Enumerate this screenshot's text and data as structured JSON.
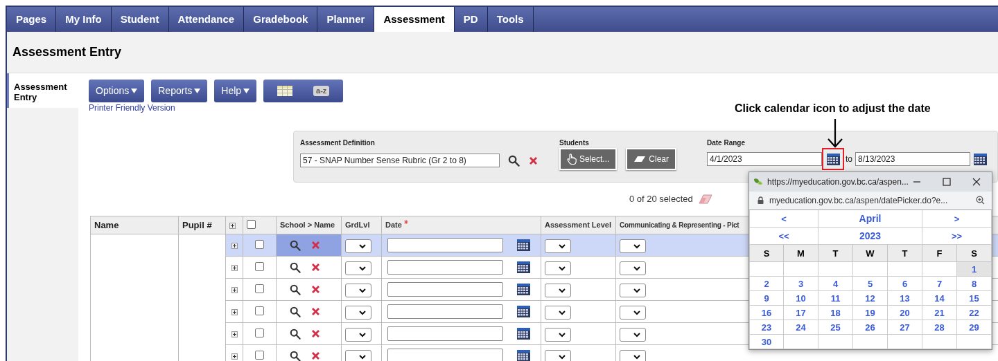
{
  "tabs": [
    {
      "label": "Pages",
      "selected": false
    },
    {
      "label": "My Info",
      "selected": false
    },
    {
      "label": "Student",
      "selected": false
    },
    {
      "label": "Attendance",
      "selected": false
    },
    {
      "label": "Gradebook",
      "selected": false
    },
    {
      "label": "Planner",
      "selected": false
    },
    {
      "label": "Assessment",
      "selected": true
    },
    {
      "label": "PD",
      "selected": false
    },
    {
      "label": "Tools",
      "selected": false
    }
  ],
  "page_title": "Assessment Entry",
  "side_nav": [
    {
      "label": "Assessment Entry",
      "selected": true
    }
  ],
  "toolbar": {
    "menus": [
      "Options",
      "Reports",
      "Help"
    ],
    "view_buttons": [
      {
        "kind": "grid"
      },
      {
        "kind": "sort",
        "label": "a-z"
      }
    ]
  },
  "printer_link": "Printer Friendly Version",
  "annotation": "Click calendar icon to adjust the date",
  "filter": {
    "assessment_definition": {
      "label": "Assessment Definition",
      "value": "57 - SNAP Number Sense Rubric (Gr 2 to 8)"
    },
    "students": {
      "label": "Students",
      "buttons": [
        {
          "kind": "select",
          "label": "Select..."
        },
        {
          "kind": "clear",
          "label": "Clear"
        }
      ]
    },
    "date_range": {
      "label": "Date Range",
      "from": "4/1/2023",
      "connector": "to",
      "to": "8/13/2023"
    }
  },
  "selection_count": "0 of 20 selected",
  "table": {
    "columns": [
      {
        "kind": "text",
        "label": "Name"
      },
      {
        "kind": "text",
        "label": "Pupil #"
      },
      {
        "kind": "expand"
      },
      {
        "kind": "checkbox",
        "checked": false
      },
      {
        "kind": "lookup",
        "label": "School > Name"
      },
      {
        "kind": "select",
        "label": "GrdLvl"
      },
      {
        "kind": "date",
        "label": "Date",
        "required": true
      },
      {
        "kind": "select",
        "label": "Assessment Level"
      },
      {
        "kind": "select",
        "label": "Communicating & Representing - Pict"
      }
    ],
    "rows": [
      {
        "selected": true,
        "checked": false
      },
      {
        "selected": false,
        "checked": false
      },
      {
        "selected": false,
        "checked": false
      },
      {
        "selected": false,
        "checked": false
      },
      {
        "selected": false,
        "checked": false
      },
      {
        "selected": false,
        "checked": false
      }
    ]
  },
  "date_picker": {
    "window_title": "https://myeducation.gov.bc.ca/aspen...",
    "address": "myeducation.gov.bc.ca/aspen/datePicker.do?e...",
    "prev_month": "<",
    "month": "April",
    "next_month": ">",
    "prev_year": "<<",
    "year": "2023",
    "next_year": ">>",
    "weekdays": [
      "S",
      "M",
      "T",
      "W",
      "T",
      "F",
      "S"
    ],
    "weeks": [
      {
        "kind": "first",
        "days": [
          {
            "day": "1",
            "selected": true
          }
        ]
      },
      {
        "kind": "full",
        "days": [
          {
            "day": "2",
            "selected": false
          },
          {
            "day": "3",
            "selected": false
          },
          {
            "day": "4",
            "selected": false
          },
          {
            "day": "5",
            "selected": false
          },
          {
            "day": "6",
            "selected": false
          },
          {
            "day": "7",
            "selected": false
          },
          {
            "day": "8",
            "selected": false
          }
        ]
      },
      {
        "kind": "full",
        "days": [
          {
            "day": "9",
            "selected": false
          },
          {
            "day": "10",
            "selected": false
          },
          {
            "day": "11",
            "selected": false
          },
          {
            "day": "12",
            "selected": false
          },
          {
            "day": "13",
            "selected": false
          },
          {
            "day": "14",
            "selected": false
          },
          {
            "day": "15",
            "selected": false
          }
        ]
      },
      {
        "kind": "full",
        "days": [
          {
            "day": "16",
            "selected": false
          },
          {
            "day": "17",
            "selected": false
          },
          {
            "day": "18",
            "selected": false
          },
          {
            "day": "19",
            "selected": false
          },
          {
            "day": "20",
            "selected": false
          },
          {
            "day": "21",
            "selected": false
          },
          {
            "day": "22",
            "selected": false
          }
        ]
      },
      {
        "kind": "full",
        "days": [
          {
            "day": "23",
            "selected": false
          },
          {
            "day": "24",
            "selected": false
          },
          {
            "day": "25",
            "selected": false
          },
          {
            "day": "26",
            "selected": false
          },
          {
            "day": "27",
            "selected": false
          },
          {
            "day": "28",
            "selected": false
          },
          {
            "day": "29",
            "selected": false
          }
        ]
      },
      {
        "kind": "last",
        "days": [
          {
            "day": "30",
            "selected": false
          }
        ]
      }
    ]
  }
}
